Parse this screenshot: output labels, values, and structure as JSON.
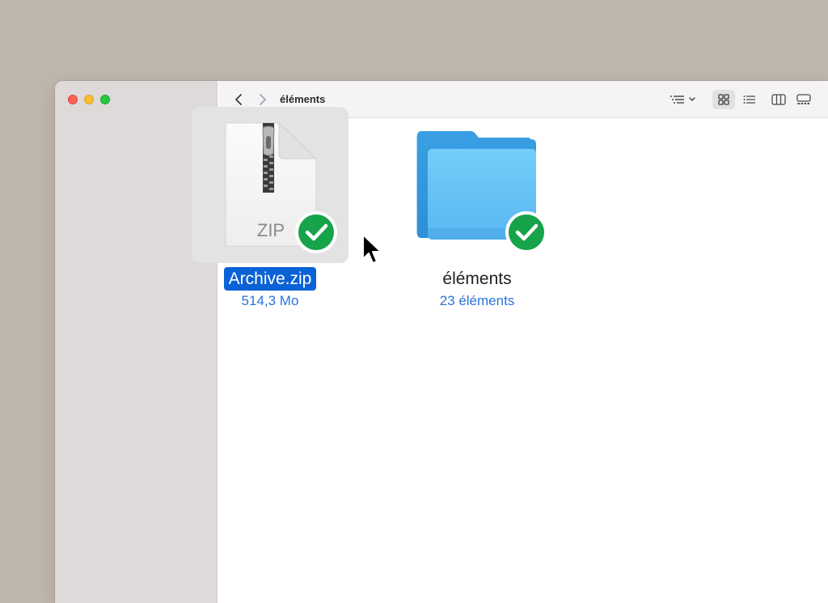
{
  "window": {
    "title": "éléments",
    "controls": {
      "close_color": "#fe5f57",
      "minimize_color": "#febc2e",
      "zoom_color": "#28c840"
    }
  },
  "toolbar": {
    "back_icon": "chevron-left-icon",
    "forward_icon": "chevron-right-icon",
    "title": "éléments",
    "view_modes": [
      "icons",
      "list",
      "columns",
      "gallery"
    ],
    "active_view": "icons"
  },
  "items": [
    {
      "name": "Archive.zip",
      "meta": "514,3 Mo",
      "icon": "zip-file-icon",
      "icon_label": "ZIP",
      "selected": true,
      "synced": true
    },
    {
      "name": "éléments",
      "meta": "23 éléments",
      "icon": "folder-icon",
      "selected": false,
      "synced": true
    }
  ],
  "colors": {
    "selection": "#0a62d6",
    "meta_text": "#2a73d9",
    "check_badge": "#16a34a",
    "folder": "#5ab7f1"
  }
}
